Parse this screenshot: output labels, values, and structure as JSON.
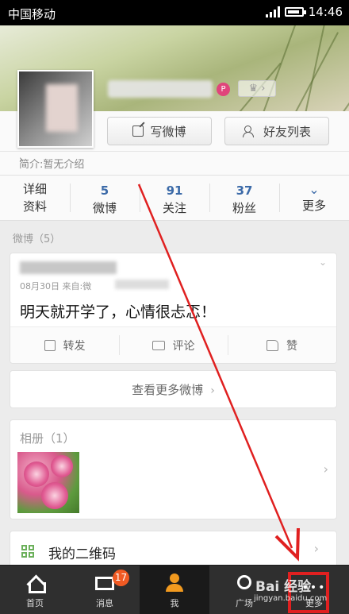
{
  "status_bar": {
    "carrier": "中国移动",
    "time": "14:46"
  },
  "profile": {
    "compose_label": "写微博",
    "friends_label": "好友列表",
    "intro": "简介:暂无介绍"
  },
  "stats": {
    "details_line1": "详细",
    "details_line2": "资料",
    "posts_count": "5",
    "posts_label": "微博",
    "following_count": "91",
    "following_label": "关注",
    "fans_count": "37",
    "fans_label": "粉丝",
    "more_label": "更多"
  },
  "section": {
    "weibo_header": "微博（5）"
  },
  "post": {
    "meta": "08月30日  来自:微",
    "text": "明天就开学了，心情很忐忑！",
    "actions": [
      "转发",
      "评论",
      "赞"
    ]
  },
  "more_posts_label": "查看更多微博",
  "album": {
    "title": "相册（1）"
  },
  "qr_label": "我的二维码",
  "bottom_nav": {
    "items": [
      "首页",
      "消息",
      "我",
      "广场",
      "更多"
    ],
    "messages_badge": "17"
  },
  "watermark": {
    "brand": "Bai 经验",
    "url": "jingyan.baidu.com"
  },
  "colors": {
    "accent_blue": "#3b6aa8",
    "annotation_red": "#e02020",
    "nav_bg": "#2f2f2f"
  }
}
